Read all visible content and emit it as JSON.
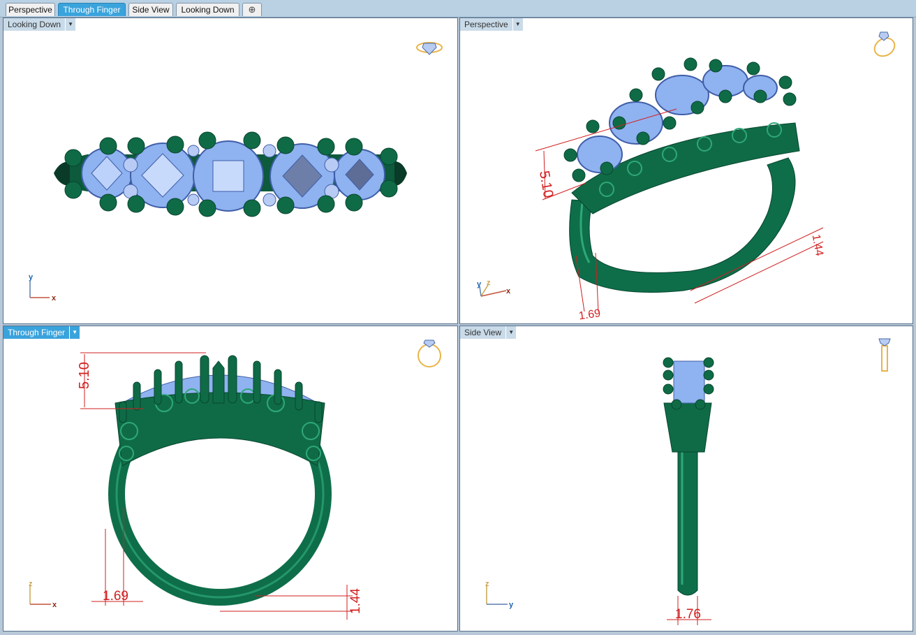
{
  "tabs": [
    {
      "label": "Perspective"
    },
    {
      "label": "Through Finger"
    },
    {
      "label": "Side View"
    },
    {
      "label": "Looking Down"
    }
  ],
  "add_tab_icon": "plus-icon",
  "viewports": {
    "top_left": {
      "title": "Looking Down",
      "axes": {
        "v": "y",
        "h": "x"
      }
    },
    "top_right": {
      "title": "Perspective",
      "axes": {
        "v1": "y",
        "v2": "z",
        "h": "x"
      },
      "dims": {
        "height": "5.10",
        "shank_top": "1.69",
        "width": "1.44"
      }
    },
    "bottom_left": {
      "title": "Through Finger",
      "axes": {
        "v": "z",
        "h": "x"
      },
      "dims": {
        "height": "5.10",
        "shank_width": "1.69",
        "shank_thick": "1.44"
      }
    },
    "bottom_right": {
      "title": "Side View",
      "axes": {
        "v": "z",
        "h": "y"
      },
      "dims": {
        "shank_width": "1.76"
      }
    }
  },
  "colors": {
    "metal": "#0e6e4a",
    "metal_light": "#2fa878",
    "gem": "#8fb2f0",
    "gem_edge": "#3f5ea8",
    "dimension": "#d21f1f",
    "active_tab": "#3aa3dc"
  }
}
